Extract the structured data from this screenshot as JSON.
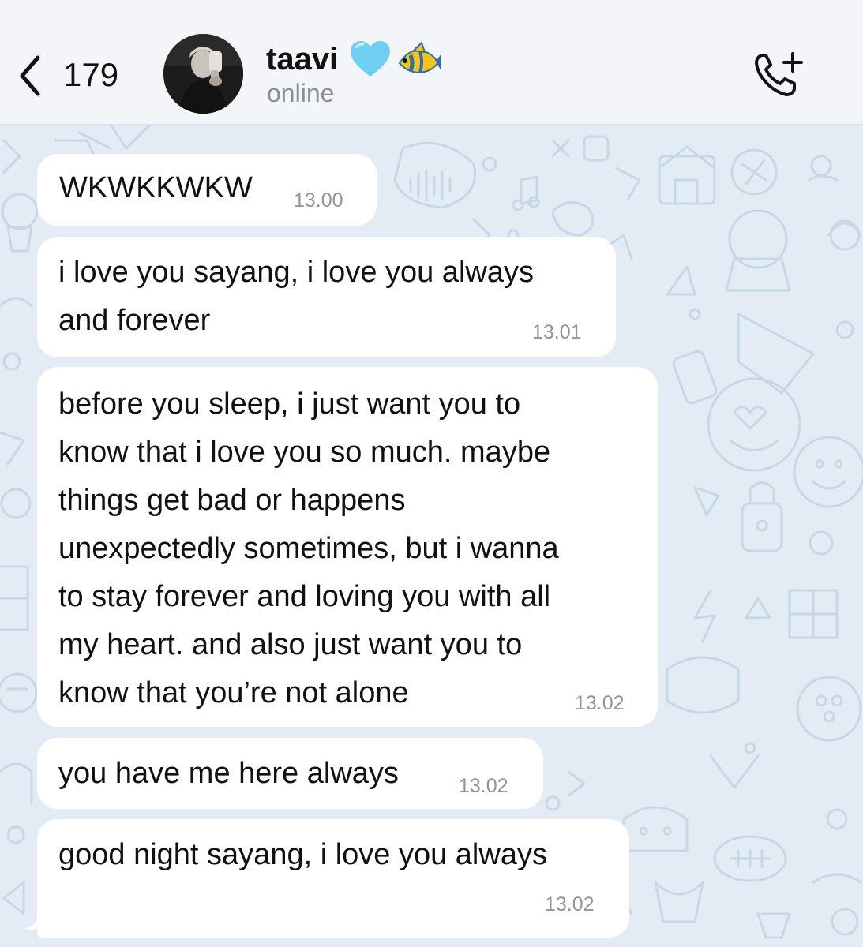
{
  "header": {
    "back_count": "179",
    "contact_name": "taavi",
    "status": "online",
    "emojis": [
      "light-blue-heart",
      "tropical-fish"
    ]
  },
  "messages": [
    {
      "text": "WKWKKWKW",
      "time": "13.00"
    },
    {
      "text": "i love you sayang, i love you always\nand forever",
      "time": "13.01"
    },
    {
      "text": "before you sleep, i just want you to\nknow that i love you so much. maybe\nthings get bad or happens\nunexpectedly sometimes, but i wanna\nto stay forever and loving you with all\nmy heart. and also just want you to\nknow that you’re not alone",
      "time": "13.02"
    },
    {
      "text": "you have me here always",
      "time": "13.02"
    },
    {
      "text": "good night sayang, i love you always",
      "time": "13.02"
    }
  ],
  "colors": {
    "header_bg": "#f3f5f8",
    "chat_bg": "#e3ecf4",
    "bubble_bg": "#ffffff",
    "doodle": "#c6d8e8",
    "text": "#111111",
    "muted": "#8a8f96"
  }
}
